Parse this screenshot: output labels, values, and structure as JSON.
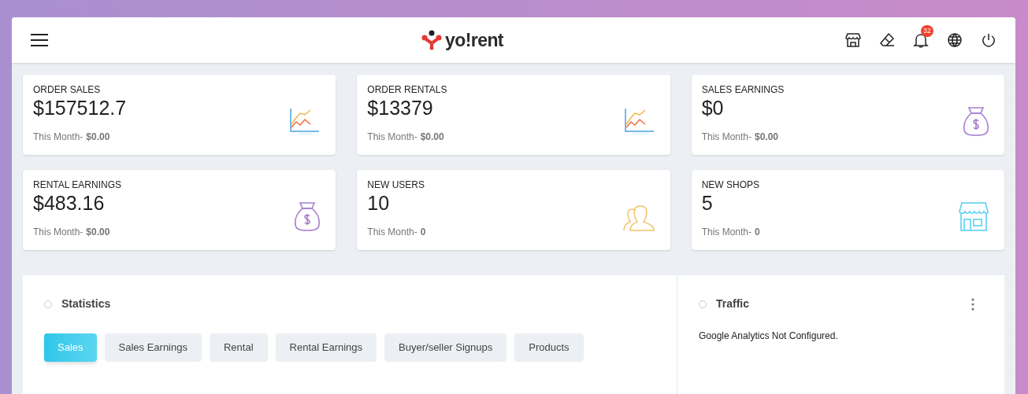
{
  "header": {
    "logo_text": "yo!rent",
    "notification_count": "32"
  },
  "stats": [
    {
      "title": "ORDER SALES",
      "value": "$157512.7",
      "sub_label": "This Month-",
      "sub_value": "$0.00",
      "kind": "chart"
    },
    {
      "title": "ORDER RENTALS",
      "value": "$13379",
      "sub_label": "This Month-",
      "sub_value": "$0.00",
      "kind": "chart"
    },
    {
      "title": "SALES EARNINGS",
      "value": "$0",
      "sub_label": "This Month-",
      "sub_value": "$0.00",
      "kind": "moneybag"
    },
    {
      "title": "RENTAL EARNINGS",
      "value": "$483.16",
      "sub_label": "This Month-",
      "sub_value": "$0.00",
      "kind": "moneybag"
    },
    {
      "title": "NEW USERS",
      "value": "10",
      "sub_label": "This Month-",
      "sub_value": "0",
      "kind": "users"
    },
    {
      "title": "NEW SHOPS",
      "value": "5",
      "sub_label": "This Month-",
      "sub_value": "0",
      "kind": "shop"
    }
  ],
  "statistics": {
    "title": "Statistics",
    "tabs": [
      {
        "label": "Sales",
        "selected": true
      },
      {
        "label": "Sales Earnings",
        "selected": false
      },
      {
        "label": "Rental",
        "selected": false
      },
      {
        "label": "Rental Earnings",
        "selected": false
      },
      {
        "label": "Buyer/seller Signups",
        "selected": false
      },
      {
        "label": "Products",
        "selected": false
      }
    ]
  },
  "traffic": {
    "title": "Traffic",
    "message": "Google Analytics Not Configured."
  }
}
